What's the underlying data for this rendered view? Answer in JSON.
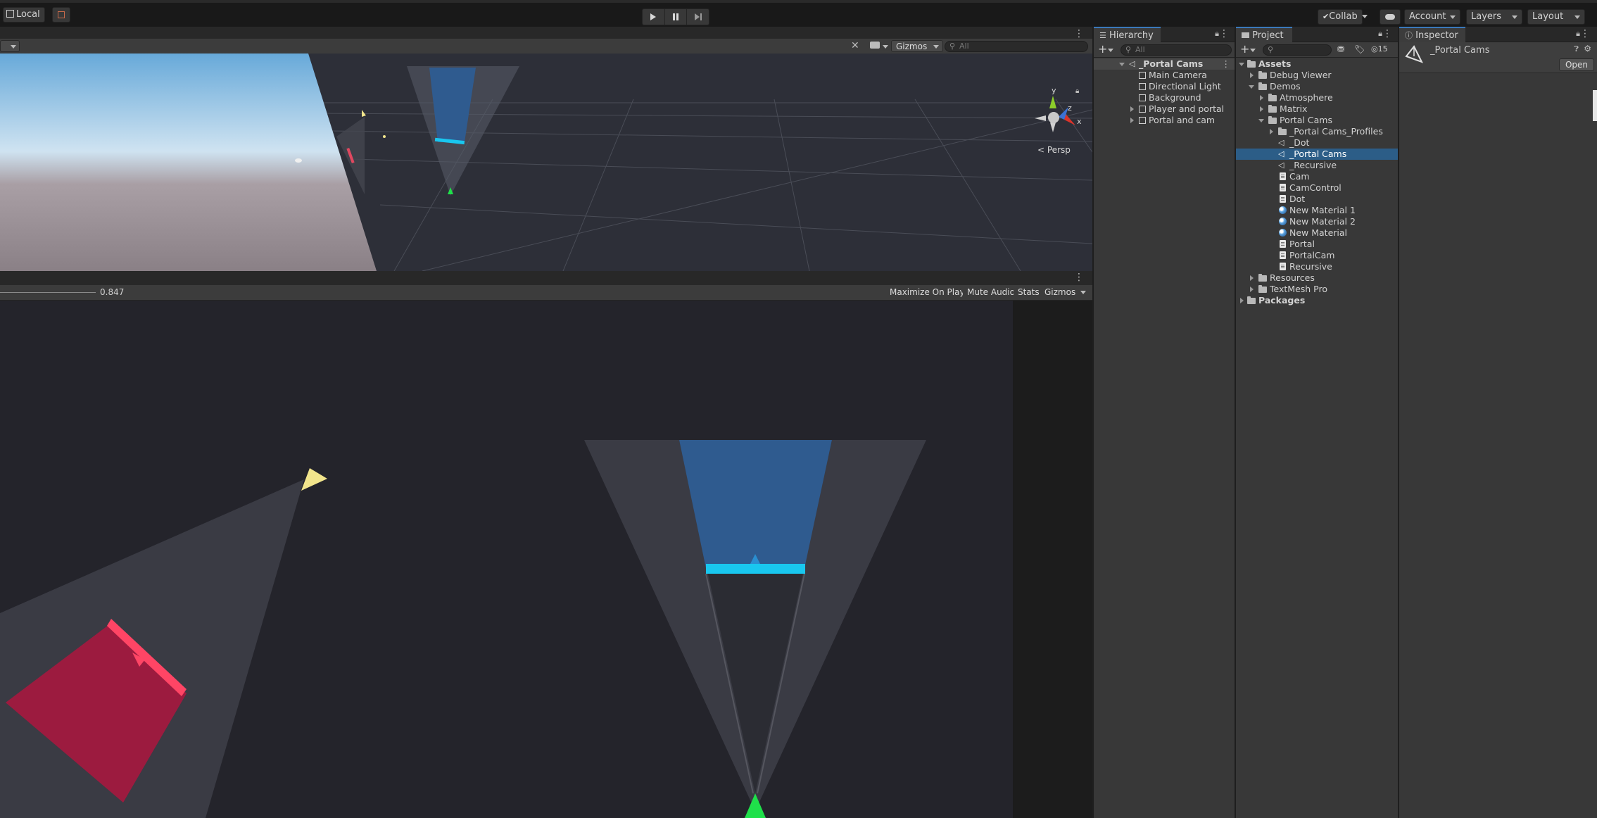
{
  "toolbar": {
    "local_label": "Local",
    "collab_label": "Collab",
    "account_label": "Account",
    "layers_label": "Layers",
    "layout_label": "Layout"
  },
  "scene": {
    "gizmos_label": "Gizmos",
    "search_placeholder": "All",
    "persp_label": "Persp",
    "axis_y": "y",
    "axis_z": "z",
    "axis_x": "x"
  },
  "game": {
    "scale_value": "0.847",
    "maximize_label": "Maximize On Play",
    "mute_label": "Mute Audio",
    "stats_label": "Stats",
    "gizmos_label": "Gizmos"
  },
  "hierarchy": {
    "tab_label": "Hierarchy",
    "search_placeholder": "All",
    "items": [
      {
        "label": "_Portal Cams"
      },
      {
        "label": "Main Camera"
      },
      {
        "label": "Directional Light"
      },
      {
        "label": "Background"
      },
      {
        "label": "Player and portal"
      },
      {
        "label": "Portal and cam"
      }
    ]
  },
  "project": {
    "tab_label": "Project",
    "hidden_count": "15",
    "items": [
      {
        "label": "Assets"
      },
      {
        "label": "Debug Viewer"
      },
      {
        "label": "Demos"
      },
      {
        "label": "Atmosphere"
      },
      {
        "label": "Matrix"
      },
      {
        "label": "Portal Cams"
      },
      {
        "label": "_Portal Cams_Profiles"
      },
      {
        "label": "_Dot"
      },
      {
        "label": "_Portal Cams"
      },
      {
        "label": "_Recursive"
      },
      {
        "label": "Cam"
      },
      {
        "label": "CamControl"
      },
      {
        "label": "Dot"
      },
      {
        "label": "New Material 1"
      },
      {
        "label": "New Material 2"
      },
      {
        "label": "New Material"
      },
      {
        "label": "Portal"
      },
      {
        "label": "PortalCam"
      },
      {
        "label": "Recursive"
      },
      {
        "label": "Resources"
      },
      {
        "label": "TextMesh Pro"
      },
      {
        "label": "Packages"
      }
    ]
  },
  "inspector": {
    "tab_label": "Inspector",
    "asset_name": "_Portal Cams",
    "open_label": "Open"
  },
  "colors": {
    "selection": "#2c5d87",
    "tab_accent": "#3a79bb",
    "portal_blue": "#2f5b8f",
    "portal_cyan": "#19c7ef",
    "crimson": "#9c1b3f",
    "yellow": "#f2e58c",
    "green": "#1fe04a"
  }
}
